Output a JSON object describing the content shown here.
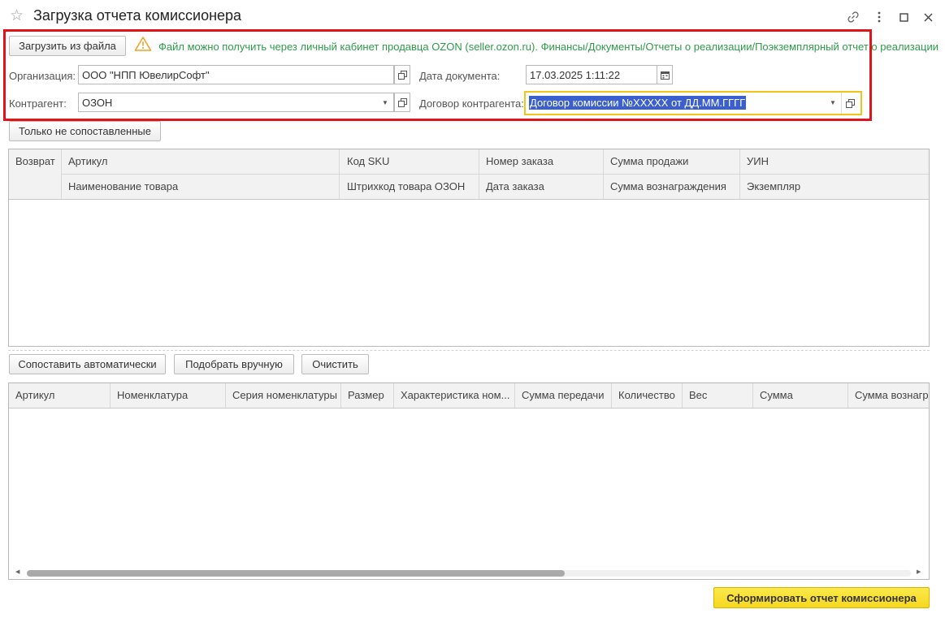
{
  "window": {
    "title": "Загрузка отчета комиссионера"
  },
  "toolbar": {
    "load_button": "Загрузить из файла",
    "warning_text": "Файл можно получить через личный кабинет продавца OZON (seller.ozon.ru). Финансы/Документы/Отчеты о реализации/Поэкземплярный отчет о реализации"
  },
  "form": {
    "org_label": "Организация:",
    "org_value": "ООО \"НПП ЮвелирСофт\"",
    "contragent_label": "Контрагент:",
    "contragent_value": "ОЗОН",
    "date_label": "Дата документа:",
    "date_value": "17.03.2025  1:11:22",
    "contract_label": "Договор контрагента:",
    "contract_value": "Договор комиссии №XXXXX от ДД.ММ.ГГГГ"
  },
  "filter_button": "Только не сопоставленные",
  "top_table": {
    "row1": [
      "Возврат",
      "Артикул",
      "Код SKU",
      "Номер заказа",
      "Сумма продажи",
      "УИН"
    ],
    "row2": [
      "Наименование товара",
      "Штрихкод товара ОЗОН",
      "Дата заказа",
      "Сумма вознаграждения",
      "Экземпляр"
    ]
  },
  "actions": {
    "auto_match": "Сопоставить автоматически",
    "manual_pick": "Подобрать вручную",
    "clear": "Очистить"
  },
  "bottom_table": {
    "columns": [
      "Артикул",
      "Номенклатура",
      "Серия номенклатуры",
      "Размер",
      "Характеристика ном...",
      "Сумма передачи",
      "Количество",
      "Вес",
      "Сумма",
      "Сумма вознагр"
    ]
  },
  "submit_button": "Сформировать отчет комиссионера",
  "colors": {
    "highlight_frame": "#e0141a",
    "warning_text": "#2e9a4a",
    "primary_button": "#f5d81e",
    "selection": "#3b5fcf"
  }
}
